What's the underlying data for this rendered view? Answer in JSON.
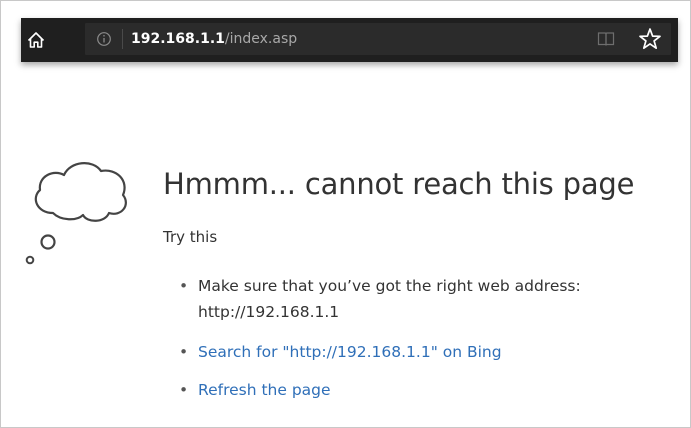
{
  "toolbar": {
    "home_icon": "home-icon",
    "info_icon": "info-icon",
    "url_host": "192.168.1.1",
    "url_path": "/index.asp",
    "reading_view_icon": "reading-view-icon",
    "favorite_icon": "star-icon"
  },
  "error_page": {
    "illustration_icon": "thought-cloud-icon",
    "title": "Hmmm... cannot reach this page",
    "try_this": "Try this",
    "suggestions": [
      {
        "text": "Make sure that you’ve got the right web address: http://192.168.1.1",
        "is_link": false
      },
      {
        "text": "Search for \"http://192.168.1.1\" on Bing",
        "is_link": true
      },
      {
        "text": "Refresh the page",
        "is_link": true
      }
    ]
  },
  "colors": {
    "toolbar_bg": "#1f1f1f",
    "address_bar_bg": "#2b2b2b",
    "link": "#2f6fb8",
    "text": "#333333"
  }
}
